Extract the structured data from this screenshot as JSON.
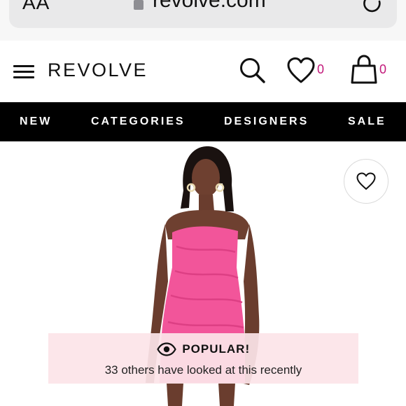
{
  "browser": {
    "text_size_label": "AA",
    "url": "revolve.com"
  },
  "header": {
    "logo": "REVOLVE",
    "wishlist_count": "0",
    "bag_count": "0"
  },
  "nav": {
    "items": [
      "NEW",
      "CATEGORIES",
      "DESIGNERS",
      "SALE"
    ]
  },
  "product": {
    "dress_color": "#f2559a",
    "popular_banner": {
      "title": "POPULAR!",
      "message": "33 others have looked at this recently"
    }
  },
  "colors": {
    "accent": "#c2187a",
    "nav_bg": "#000000",
    "banner_bg": "#fce4e8"
  }
}
